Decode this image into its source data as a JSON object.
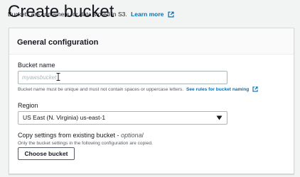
{
  "header": {
    "title": "Create bucket",
    "subtitle": "Buckets are containers for data stored in S3.",
    "learn_more": "Learn more",
    "learn_more_icon": "external-link-icon"
  },
  "general_configuration": {
    "heading": "General configuration",
    "bucket_name": {
      "label": "Bucket name",
      "placeholder": "myawsbucket",
      "value": "",
      "hint": "Bucket name must be unique and must not contain spaces or uppercase letters.",
      "hint_link": "See rules for bucket naming",
      "hint_link_icon": "external-link-icon"
    },
    "region": {
      "label": "Region",
      "selected": "US East (N. Virginia) us-east-1",
      "caret_icon": "caret-down-icon"
    },
    "copy_settings": {
      "label": "Copy settings from existing bucket -",
      "optional": "optional",
      "hint": "Only the bucket settings in the following configuration are copied.",
      "button_label": "Choose bucket"
    }
  },
  "colors": {
    "link": "#0073bb",
    "background": "#f2f3f3",
    "panel": "#ffffff",
    "border": "#aab7b8",
    "text": "#16191f",
    "muted": "#545b64"
  }
}
